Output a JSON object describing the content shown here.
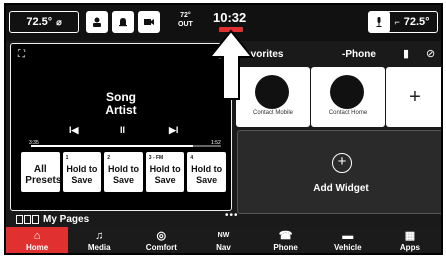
{
  "status_bar": {
    "left_temp": "72.5°",
    "out_temp": "72°",
    "out_label": "OUT",
    "clock": "10:32",
    "right_temp": "72.5°"
  },
  "media": {
    "song": "Song",
    "artist": "Artist",
    "elapsed": "3:35",
    "duration": "1:52",
    "progress": 0.85,
    "presets": [
      {
        "num": "",
        "label": "All Presets"
      },
      {
        "num": "1",
        "label": "Hold to Save"
      },
      {
        "num": "2",
        "label": "Hold to Save"
      },
      {
        "num": "3 - FM",
        "label": "Hold to Save"
      },
      {
        "num": "4",
        "label": "Hold to Save"
      }
    ]
  },
  "favorites": {
    "title": "Favorites",
    "source": "-Phone",
    "tiles": [
      {
        "label": "Contact Mobile"
      },
      {
        "label": "Contact Home"
      }
    ],
    "add_symbol": "+"
  },
  "add_widget": {
    "label": "Add Widget",
    "symbol": "+"
  },
  "pages": {
    "label": "My Pages",
    "dots": "•••"
  },
  "nav": {
    "items": [
      {
        "label": "Home",
        "icon": "home-icon",
        "glyph": "⌂"
      },
      {
        "label": "Media",
        "icon": "music-icon",
        "glyph": "♫"
      },
      {
        "label": "Comfort",
        "icon": "comfort-icon",
        "glyph": "◎"
      },
      {
        "label": "Nav",
        "icon": "compass-icon",
        "glyph": "NW"
      },
      {
        "label": "Phone",
        "icon": "phone-icon",
        "glyph": "☎"
      },
      {
        "label": "Vehicle",
        "icon": "vehicle-icon",
        "glyph": "▬"
      },
      {
        "label": "Apps",
        "icon": "apps-icon",
        "glyph": "▦"
      }
    ]
  },
  "colors": {
    "accent": "#e0302f",
    "background": "#1a1a1a"
  }
}
